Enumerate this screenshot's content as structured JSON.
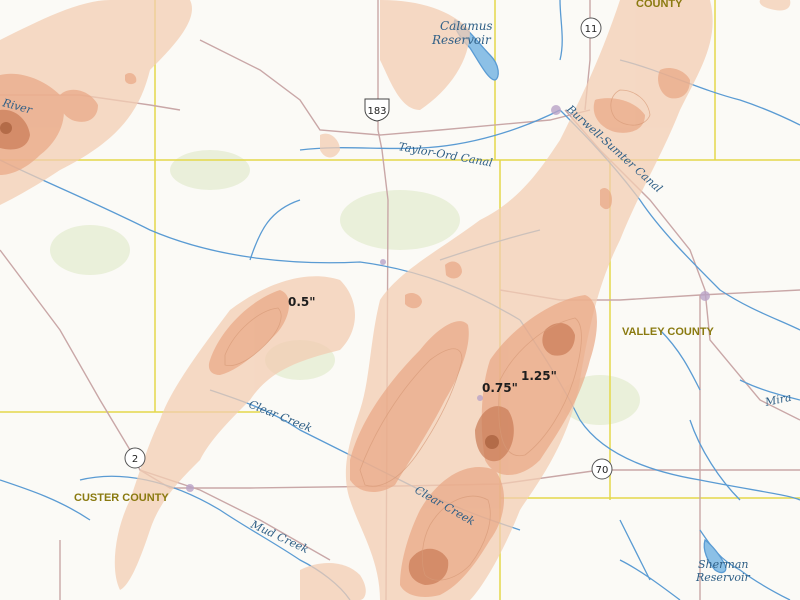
{
  "colors": {
    "background": "#fbfaf6",
    "river": "#5a9bd3",
    "road": "#c9a7a7",
    "county_line": "#e4d84a",
    "precip_low": "#f3cdb3",
    "precip_mid": "#e9a784",
    "precip_high": "#c97b55",
    "precip_peak": "#a8603d"
  },
  "map": {
    "type": "precipitation-contour-map",
    "water_labels": {
      "calamus_reservoir": "Calamus\nReservoir",
      "calamus_line1": "Calamus",
      "calamus_line2": "Reservoir",
      "taylor_ord_canal": "Taylor-Ord Canal",
      "burwell_sumter_canal": "Burwell-Sumter Canal",
      "clear_creek_1": "Clear Creek",
      "clear_creek_2": "Clear Creek",
      "mud_creek": "Mud Creek",
      "sherman_line1": "Sherman",
      "sherman_line2": "Reservoir",
      "river_partial": "River",
      "mira_partial": "Mira"
    },
    "county_labels": {
      "top_county": "COUNTY",
      "valley_county": "VALLEY COUNTY",
      "custer_county": "CUSTER COUNTY"
    },
    "contour_labels": {
      "half_inch": "0.5\"",
      "three_quarter_inch": "0.75\"",
      "one_quarter_inch": "1.25\""
    },
    "route_shields": {
      "us_183": "183",
      "hwy_11": "11",
      "hwy_2": "2",
      "hwy_70": "70"
    }
  }
}
